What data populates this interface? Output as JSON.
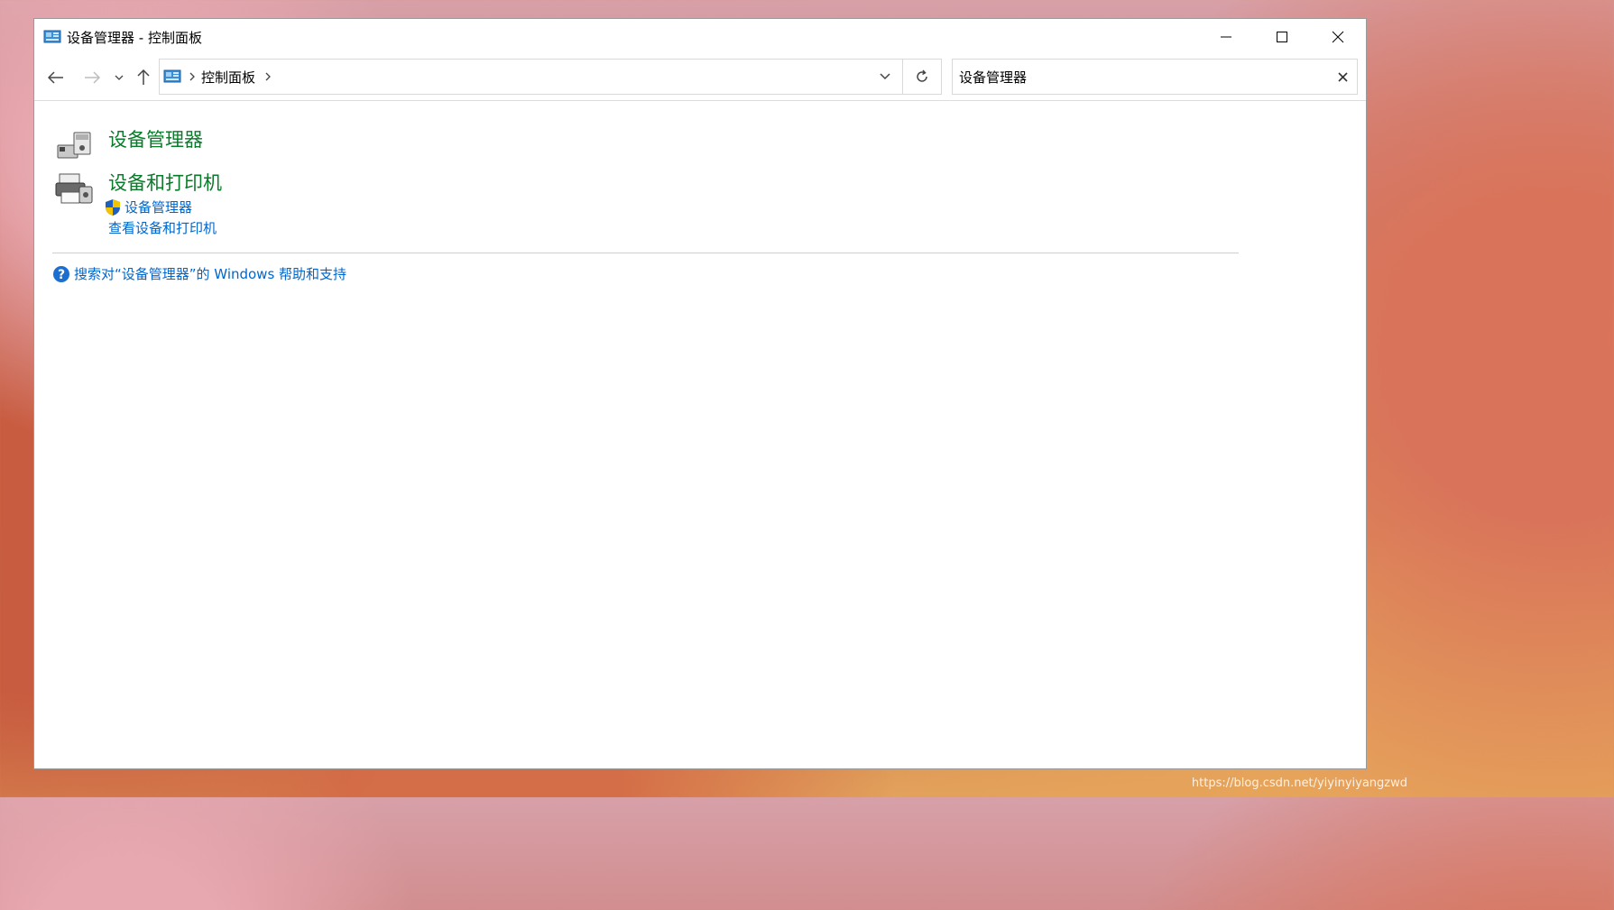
{
  "window": {
    "title": "设备管理器 - 控制面板",
    "controls": {
      "minimize": "minimize",
      "maximize": "maximize",
      "close": "close"
    }
  },
  "navbar": {
    "breadcrumb": [
      "控制面板"
    ],
    "search": {
      "value": "设备管理器"
    }
  },
  "results": [
    {
      "title": "设备管理器",
      "links": []
    },
    {
      "title": "设备和打印机",
      "links": [
        {
          "label": "设备管理器",
          "shield": true
        },
        {
          "label": "查看设备和打印机",
          "shield": false
        }
      ]
    }
  ],
  "help": {
    "label": "搜索对“设备管理器”的 Windows 帮助和支持"
  },
  "watermark": "https://blog.csdn.net/yiyinyiyangzwd",
  "colors": {
    "result_title": "#0a7a2a",
    "link": "#0066cc"
  }
}
